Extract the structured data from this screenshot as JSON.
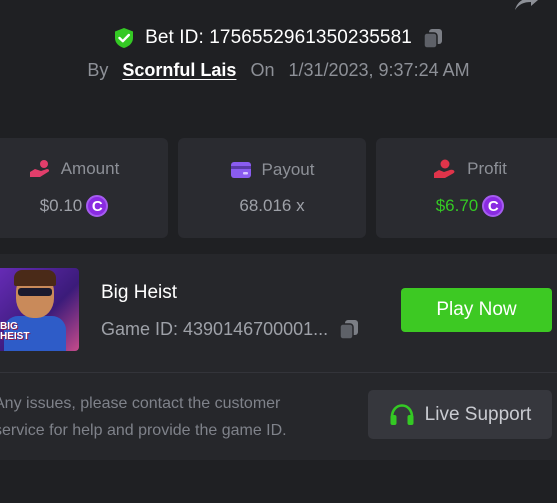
{
  "header": {
    "bet_id_text": "Bet ID: 1756552961350235581",
    "by_label": "By",
    "username": "Scornful Lais",
    "on_label": "On",
    "datetime": "1/31/2023, 9:37:24 AM"
  },
  "stats": [
    {
      "label": "Amount",
      "value": "$0.10",
      "coin": "C",
      "icon": "hand-coin-icon",
      "color": "#e23e6b"
    },
    {
      "label": "Payout",
      "value": "68.016 x",
      "icon": "wallet-card-icon",
      "color": "#8a5cf0"
    },
    {
      "label": "Profit",
      "value": "$6.70",
      "coin": "C",
      "icon": "hand-money-icon",
      "color": "#e0344a"
    }
  ],
  "game": {
    "name": "Big Heist",
    "game_id_text": "Game ID: 4390146700001...",
    "thumb_text_1": "BIG",
    "thumb_text_2": "HEIST",
    "play_label": "Play Now"
  },
  "support": {
    "notice_line1": "Any issues, please contact the customer",
    "notice_line2": "service for help and provide the game ID.",
    "button_label": "Live Support"
  },
  "colors": {
    "accent_green": "#3dc923",
    "profit_green": "#34c924",
    "coin_purple": "#8a2be2"
  }
}
